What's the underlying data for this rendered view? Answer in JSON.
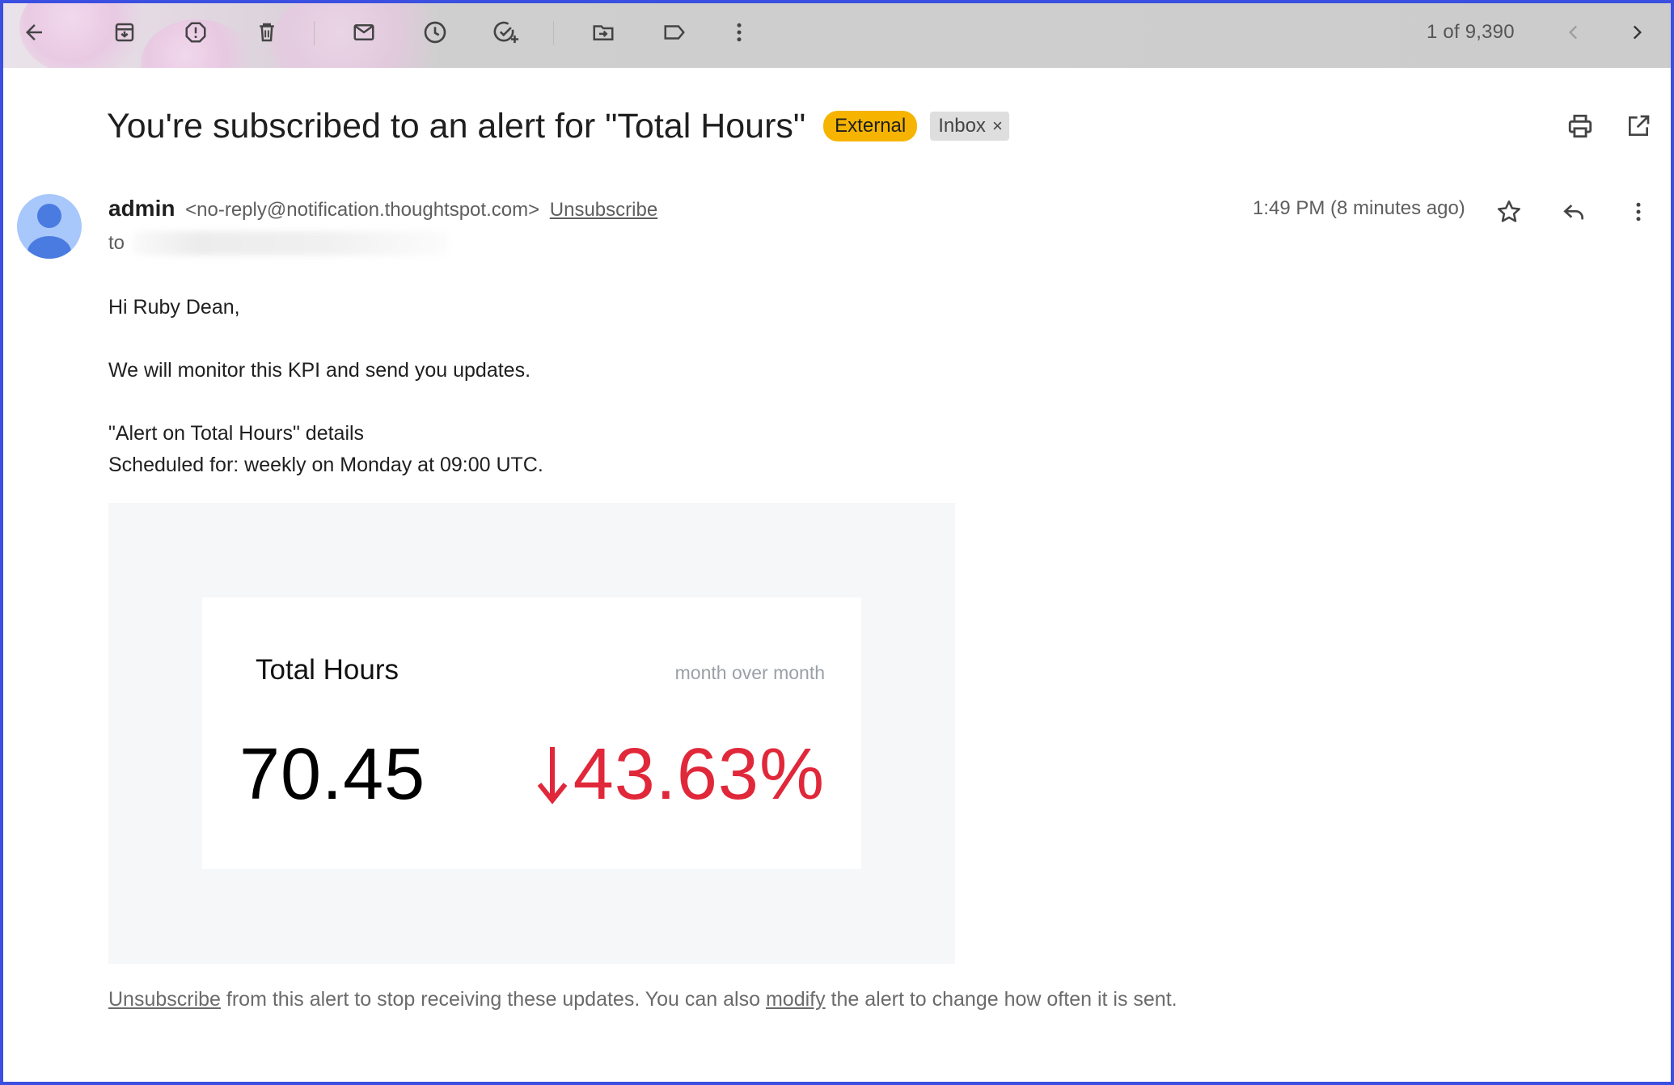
{
  "toolbar": {
    "icons": [
      "back-arrow-icon",
      "archive-icon",
      "report-spam-icon",
      "delete-icon",
      "mark-unread-icon",
      "snooze-icon",
      "add-task-icon",
      "move-to-icon",
      "label-icon",
      "more-vert-icon"
    ],
    "pager_text": "1 of 9,390"
  },
  "email": {
    "subject": "You're subscribed to an alert for \"Total Hours\"",
    "labels": {
      "external": "External",
      "inbox": "Inbox",
      "inbox_remove": "×"
    },
    "sender": {
      "name": "admin",
      "address": "<no-reply@notification.thoughtspot.com>",
      "unsubscribe": "Unsubscribe"
    },
    "to_label": "to",
    "timestamp": "1:49 PM (8 minutes ago)",
    "body": {
      "greeting": "Hi Ruby Dean,",
      "line1": "We will monitor this KPI and send you updates.",
      "details_title": "\"Alert on Total Hours\" details",
      "schedule": "Scheduled for: weekly on Monday at 09:00 UTC."
    },
    "kpi": {
      "title": "Total Hours",
      "period": "month over month",
      "value": "70.45",
      "change": "43.63%",
      "change_direction": "down",
      "change_color": "#e0283a"
    },
    "footer": {
      "unsubscribe_link": "Unsubscribe",
      "text1": " from this alert to stop receiving these updates. You can also ",
      "modify_link": "modify",
      "text2": " the alert to change how often it is sent."
    }
  },
  "colors": {
    "frame_border": "#3b4fe0",
    "external_label": "#f6b400",
    "inbox_label": "#dedede",
    "avatar_bg": "#a8c7fa",
    "avatar_fg": "#4a7be0"
  }
}
